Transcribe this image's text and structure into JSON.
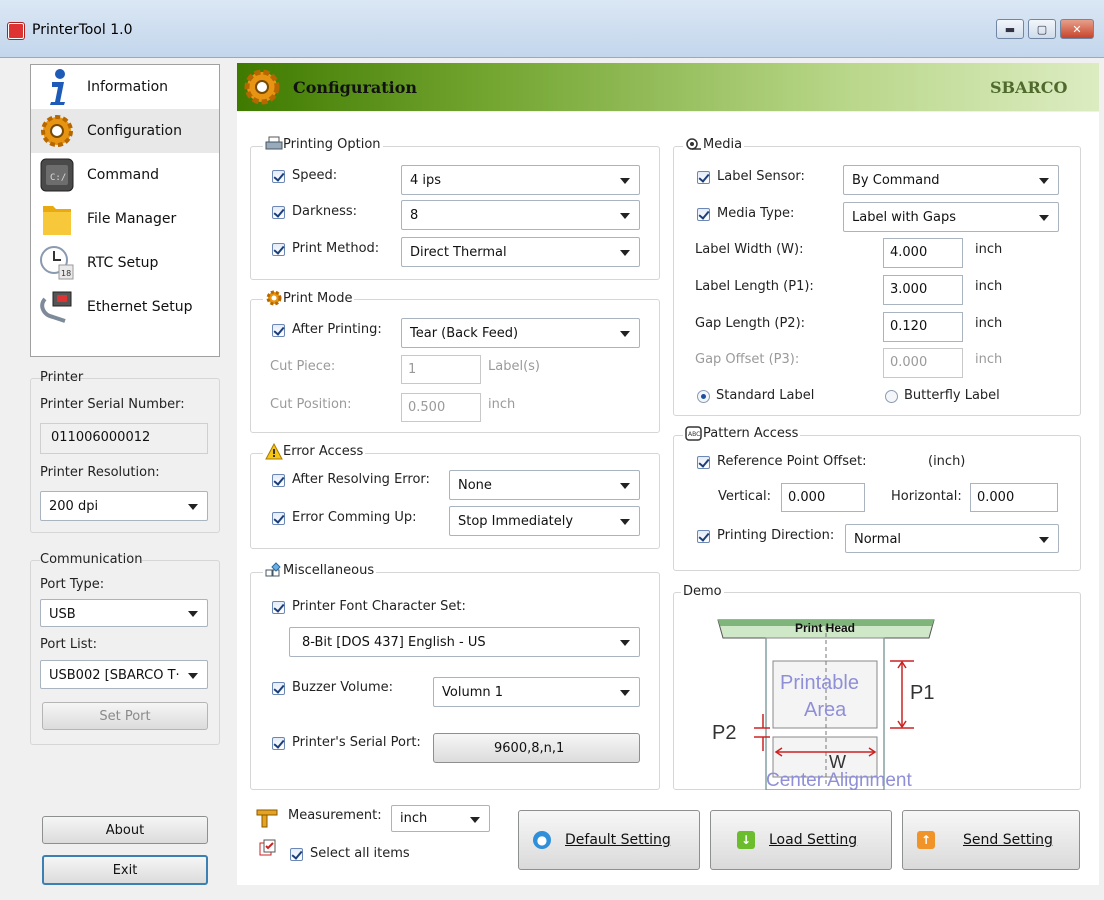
{
  "window": {
    "title": "PrinterTool 1.0",
    "min_glyph": "▬",
    "max_glyph": "▢",
    "close_glyph": "✕"
  },
  "nav": {
    "items": [
      {
        "label": "Information",
        "icon": "info-icon"
      },
      {
        "label": "Configuration",
        "icon": "gear-icon"
      },
      {
        "label": "Command",
        "icon": "terminal-icon"
      },
      {
        "label": "File Manager",
        "icon": "folder-icon"
      },
      {
        "label": "RTC Setup",
        "icon": "clock-icon"
      },
      {
        "label": "Ethernet Setup",
        "icon": "network-icon"
      }
    ],
    "active": "Configuration"
  },
  "printer": {
    "group_label": "Printer",
    "serial_label": "Printer Serial Number:",
    "serial_value": "011006000012",
    "resolution_label": "Printer Resolution:",
    "resolution_value": "200 dpi"
  },
  "communication": {
    "group_label": "Communication",
    "port_type_label": "Port Type:",
    "port_type_value": "USB",
    "port_list_label": "Port List:",
    "port_list_value": "USB002 [SBARCO T·",
    "set_port_label": "Set Port"
  },
  "footer": {
    "about_label": "About",
    "exit_label": "Exit"
  },
  "header": {
    "title": "Configuration",
    "brand": "SBARCO",
    "color_start": "#3f7a00",
    "color_end": "#c8e29a"
  },
  "printing_option": {
    "group_label": "Printing Option",
    "speed_label": "Speed:",
    "speed_value": "4 ips",
    "darkness_label": "Darkness:",
    "darkness_value": "8",
    "print_method_label": "Print Method:",
    "print_method_value": "Direct Thermal"
  },
  "print_mode": {
    "group_label": "Print Mode",
    "after_printing_label": "After Printing:",
    "after_printing_value": "Tear (Back Feed)",
    "cut_piece_label": "Cut Piece:",
    "cut_piece_value": "1",
    "cut_piece_unit": "Label(s)",
    "cut_position_label": "Cut Position:",
    "cut_position_value": "0.500",
    "cut_position_unit": "inch"
  },
  "error_access": {
    "group_label": "Error Access",
    "after_resolving_label": "After Resolving Error:",
    "after_resolving_value": "None",
    "error_coming_label": "Error Comming Up:",
    "error_coming_value": "Stop Immediately"
  },
  "misc": {
    "group_label": "Miscellaneous",
    "font_charset_label": "Printer Font Character Set:",
    "font_charset_value": "8-Bit [DOS 437] English - US",
    "buzzer_label": "Buzzer Volume:",
    "buzzer_value": "Volumn 1",
    "serial_port_label": "Printer's Serial Port:",
    "serial_port_value": "9600,8,n,1"
  },
  "media": {
    "group_label": "Media",
    "label_sensor_label": "Label Sensor:",
    "label_sensor_value": "By Command",
    "media_type_label": "Media Type:",
    "media_type_value": "Label with Gaps",
    "label_width_label": "Label Width (W):",
    "label_width_value": "4.000",
    "label_length_label": "Label Length (P1):",
    "label_length_value": "3.000",
    "gap_length_label": "Gap Length (P2):",
    "gap_length_value": "0.120",
    "gap_offset_label": "Gap Offset (P3):",
    "gap_offset_value": "0.000",
    "unit": "inch",
    "standard_label": "Standard Label",
    "butterfly_label": "Butterfly Label"
  },
  "pattern_access": {
    "group_label": "Pattern Access",
    "ref_offset_label": "Reference Point Offset:",
    "ref_offset_unit": "(inch)",
    "vertical_label": "Vertical:",
    "vertical_value": "0.000",
    "horizontal_label": "Horizontal:",
    "horizontal_value": "0.000",
    "direction_label": "Printing Direction:",
    "direction_value": "Normal"
  },
  "demo": {
    "group_label": "Demo",
    "print_head": "Print Head",
    "printable": "Printable",
    "area": "Area",
    "p1": "P1",
    "p2": "P2",
    "w": "W",
    "alignment": "Center Alignment"
  },
  "bottom": {
    "measurement_label": "Measurement:",
    "measurement_value": "inch",
    "select_all_label": "Select all items",
    "default_label": "Default Setting",
    "load_label": "Load Setting",
    "send_label": "Send Setting"
  }
}
